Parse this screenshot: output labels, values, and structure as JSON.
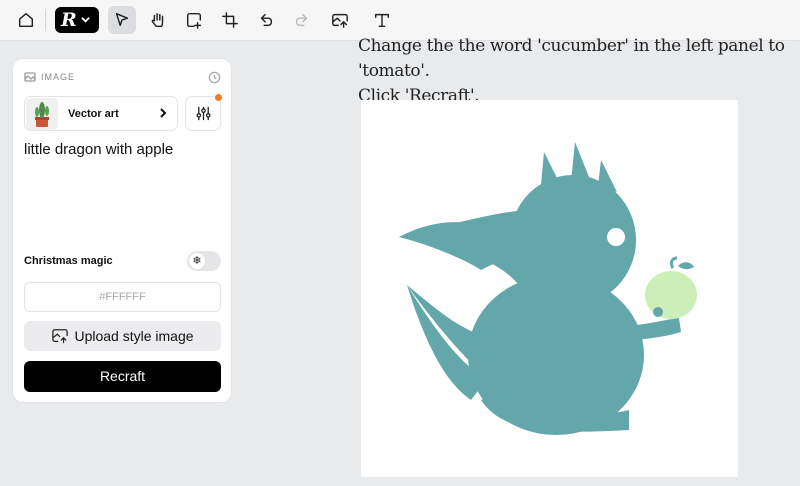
{
  "toolbar": {
    "logo_letter": "R",
    "items": [
      "home-icon",
      "logo-menu",
      "select-tool",
      "hand-tool",
      "frame-tool",
      "crop-tool",
      "undo",
      "redo",
      "upload",
      "text-tool"
    ]
  },
  "instruction": {
    "line1": "Change the the word 'cucumber' in the left panel to 'tomato'.",
    "line2": "Click 'Recraft'."
  },
  "panel": {
    "header": "IMAGE",
    "style_label": "Vector art",
    "prompt": "little dragon with apple",
    "magic_label": "Christmas magic",
    "magic_toggle_icon": "❄",
    "color_value": "#FFFFFF",
    "upload_label": "Upload style image",
    "recraft_label": "Recraft"
  },
  "canvas": {
    "dragon_color": "#63a7ab",
    "apple_color": "#ccefb9"
  }
}
